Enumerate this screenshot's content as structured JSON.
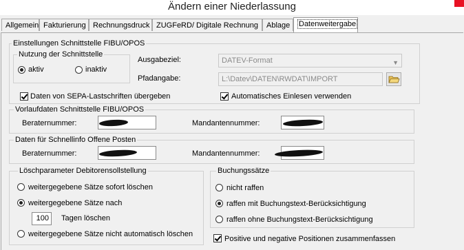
{
  "window": {
    "title": "Ändern einer Niederlassung"
  },
  "tabs": [
    {
      "label": "Allgemein"
    },
    {
      "label": "Fakturierung"
    },
    {
      "label": "Rechnungsdruck"
    },
    {
      "label": "ZUGFeRD/ Digitale Rechnung"
    },
    {
      "label": "Ablage"
    },
    {
      "label": "Datenweitergabe",
      "active": true
    }
  ],
  "fibu": {
    "legend": "Einstellungen Schnittstelle FIBU/OPOS",
    "nutzung": {
      "legend": "Nutzung der Schnittstelle",
      "aktiv": "aktiv",
      "inaktiv": "inaktiv",
      "selected": "aktiv"
    },
    "ausgabeziel_label": "Ausgabeziel:",
    "ausgabeziel_value": "DATEV-Format",
    "pfadangabe_label": "Pfadangabe:",
    "pfadangabe_value": "L:\\Datev\\DATEN\\RWDAT\\IMPORT",
    "sepa_label": "Daten von SEPA-Lastschriften übergeben",
    "sepa_checked": true,
    "auto_einlesen_label": "Automatisches Einlesen verwenden",
    "auto_einlesen_checked": true
  },
  "vorlauf": {
    "legend": "Vorlaufdaten Schnittstelle FIBU/OPOS",
    "berater_label": "Beraternummer:",
    "mandant_label": "Mandantennummer:"
  },
  "schnellinfo": {
    "legend": "Daten für Schnellinfo Offene Posten",
    "berater_label": "Beraternummer:",
    "mandant_label": "Mandantennummer:"
  },
  "loesch": {
    "legend": "Löschparameter Debitorensollstellung",
    "opt1": "weitergegebene Sätze sofort löschen",
    "opt2": "weitergegebene Sätze nach",
    "days_value": "100",
    "days_label": "Tagen löschen",
    "opt3": "weitergegebene Sätze nicht automatisch löschen",
    "selected": "opt2"
  },
  "buchung": {
    "legend": "Buchungssätze",
    "opt1": "nicht raffen",
    "opt2": "raffen mit Buchungstext-Berücksichtigung",
    "opt3": "raffen ohne Buchungstext-Berücksichtigung",
    "selected": "opt2",
    "positive_label": "Positive und negative Positionen zusammenfassen",
    "positive_checked": true
  }
}
